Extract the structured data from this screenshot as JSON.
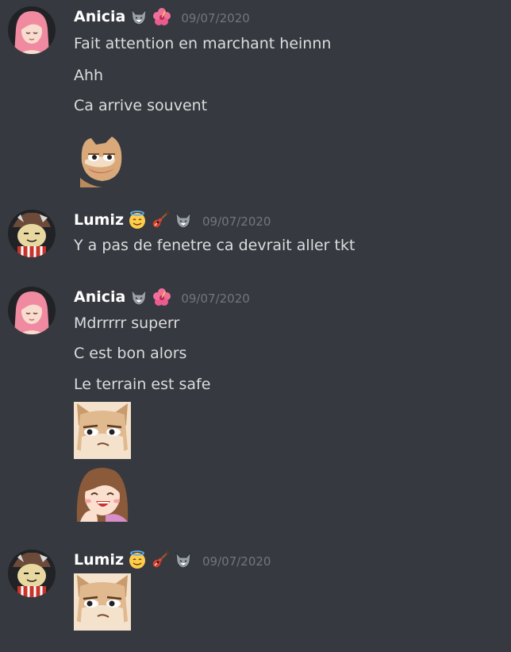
{
  "messages": [
    {
      "author": "Anicia",
      "badges": [
        "wolf-badge-icon",
        "hibiscus-flower-icon"
      ],
      "timestamp": "09/07/2020",
      "lines": [
        "Fait attention en marchant heinnn",
        "Ahh",
        "Ca arrive souvent"
      ],
      "emotes": [
        "pepe-cat-emote"
      ]
    },
    {
      "author": "Lumiz",
      "badges": [
        "angel-face-emoji-icon",
        "guitar-icon",
        "wolf-badge-icon"
      ],
      "timestamp": "09/07/2020",
      "lines": [
        "Y a pas de fenetre ca devrait aller tkt"
      ],
      "emotes": []
    },
    {
      "author": "Anicia",
      "badges": [
        "wolf-badge-icon",
        "hibiscus-flower-icon"
      ],
      "timestamp": "09/07/2020",
      "lines": [
        "Mdrrrrr superr",
        "C est bon alors",
        "Le terrain est safe"
      ],
      "emotes": [
        "smug-cat-emote",
        "laughing-girl-emote"
      ]
    },
    {
      "author": "Lumiz",
      "badges": [
        "angel-face-emoji-icon",
        "guitar-icon",
        "wolf-badge-icon"
      ],
      "timestamp": "09/07/2020",
      "lines": [],
      "emotes": [
        "smug-cat-emote"
      ]
    }
  ],
  "colors": {
    "background": "#36393f",
    "text": "#dcddde",
    "username": "#ffffff",
    "timestamp": "#72767d"
  }
}
